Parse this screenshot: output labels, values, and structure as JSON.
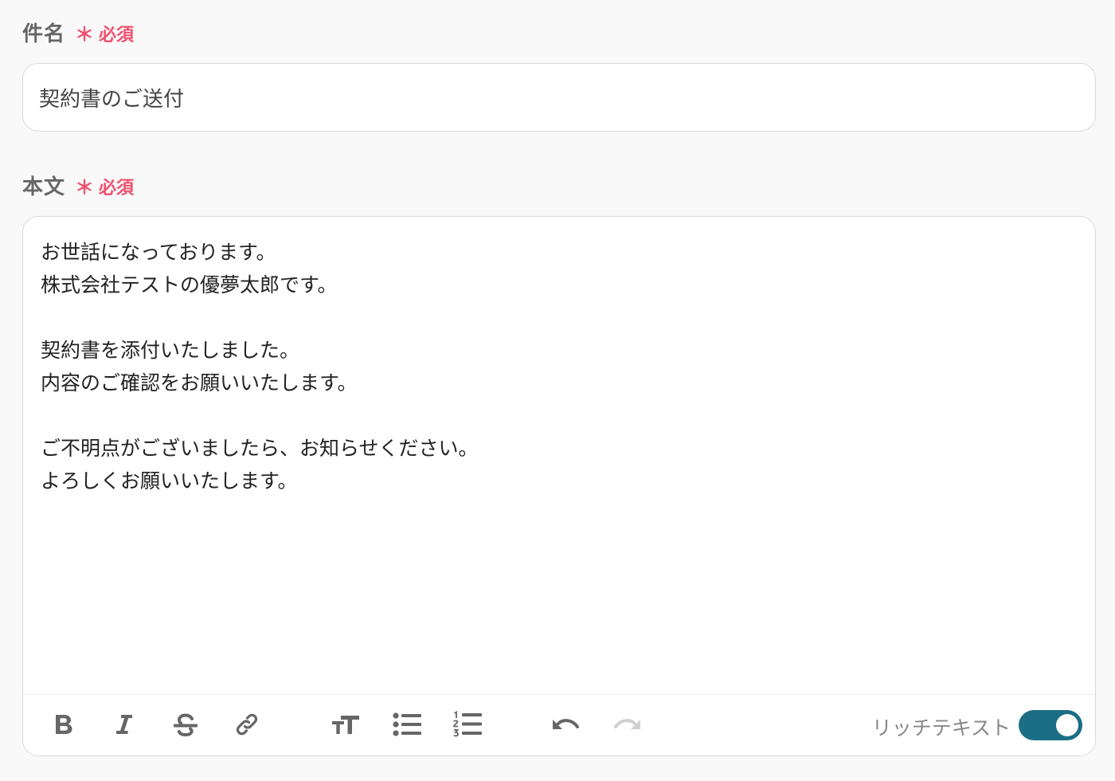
{
  "subject_field": {
    "label": "件名",
    "required_mark": "＊",
    "required_text": "必須",
    "value": "契約書のご送付"
  },
  "body_field": {
    "label": "本文",
    "required_mark": "＊",
    "required_text": "必須",
    "lines": [
      "お世話になっております。",
      "株式会社テストの優夢太郎です。",
      "",
      "契約書を添付いたしました。",
      "内容のご確認をお願いいたします。",
      "",
      "ご不明点がございましたら、お知らせください。",
      "よろしくお願いいたします。"
    ]
  },
  "toolbar": {
    "tools": [
      {
        "name": "bold-icon",
        "enabled": true
      },
      {
        "name": "italic-icon",
        "enabled": true
      },
      {
        "name": "strikethrough-icon",
        "enabled": true
      },
      {
        "name": "link-icon",
        "enabled": true
      },
      {
        "name": "text-size-icon",
        "enabled": true
      },
      {
        "name": "bulleted-list-icon",
        "enabled": true
      },
      {
        "name": "numbered-list-icon",
        "enabled": true
      },
      {
        "name": "undo-icon",
        "enabled": true
      },
      {
        "name": "redo-icon",
        "enabled": false
      }
    ],
    "rich_text_label": "リッチテキスト",
    "rich_text_enabled": true
  },
  "colors": {
    "required": "#f0506e",
    "toggle_on": "#1b6e86",
    "icon": "#666666",
    "icon_disabled": "#cccccc"
  }
}
